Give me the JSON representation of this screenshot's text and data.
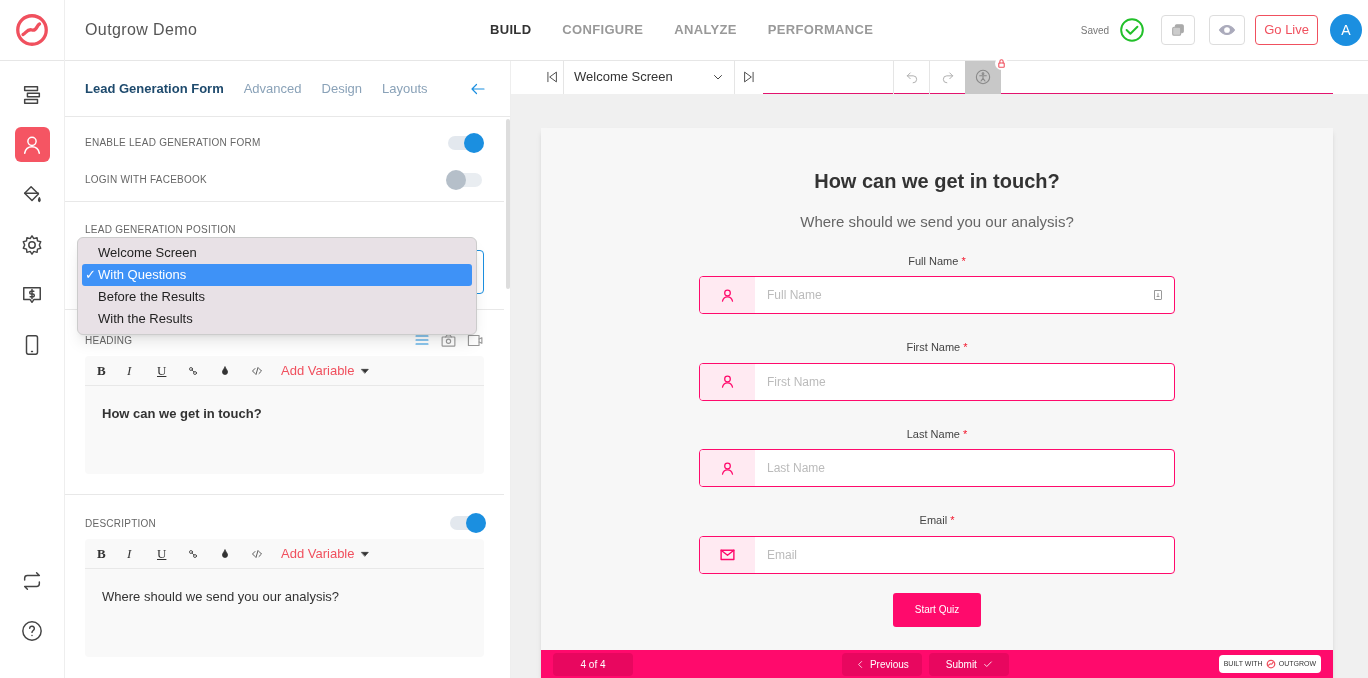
{
  "app": {
    "title": "Outgrow Demo"
  },
  "nav": [
    {
      "label": "BUILD",
      "selected": true
    },
    {
      "label": "CONFIGURE",
      "selected": false
    },
    {
      "label": "ANALYZE",
      "selected": false
    },
    {
      "label": "PERFORMANCE",
      "selected": false
    }
  ],
  "header": {
    "saved": "Saved",
    "go_live": "Go Live",
    "avatar": "A"
  },
  "rail": {
    "items": [
      {
        "kind": "layout",
        "selected": false
      },
      {
        "kind": "user",
        "selected": true
      },
      {
        "kind": "paint",
        "selected": false
      },
      {
        "kind": "gear",
        "selected": false
      },
      {
        "kind": "money",
        "selected": false
      },
      {
        "kind": "mobile",
        "selected": false
      }
    ],
    "bottom": [
      {
        "kind": "sync"
      },
      {
        "kind": "help"
      }
    ]
  },
  "panel": {
    "tabs": [
      {
        "label": "Lead Generation Form",
        "selected": true
      },
      {
        "label": "Advanced",
        "selected": false
      },
      {
        "label": "Design",
        "selected": false
      },
      {
        "label": "Layouts",
        "selected": false
      }
    ],
    "toggles": [
      {
        "label": "ENABLE LEAD GENERATION FORM",
        "on": true
      },
      {
        "label": "LOGIN WITH FACEBOOK",
        "on": false
      }
    ],
    "position": {
      "label": "LEAD GENERATION POSITION",
      "options": [
        {
          "label": "Welcome Screen",
          "selected": false
        },
        {
          "label": "With Questions",
          "selected": true
        },
        {
          "label": "Before the Results",
          "selected": false
        },
        {
          "label": "With the Results",
          "selected": false
        }
      ],
      "check": "✓"
    },
    "editors": [
      {
        "label": "HEADING",
        "kind": "heading",
        "format": [
          "B",
          "I",
          "U"
        ],
        "add_variable": "Add Variable",
        "content": "How can we get in touch?"
      },
      {
        "label": "DESCRIPTION",
        "kind": "description",
        "on": true,
        "format": [
          "B",
          "I",
          "U"
        ],
        "add_variable": "Add Variable",
        "content": "Where should we send you our analysis?"
      }
    ]
  },
  "toolbar": {
    "screen": "Welcome Screen"
  },
  "preview": {
    "title": "How can we get in touch?",
    "subtitle": "Where should we send you our analysis?",
    "fields": [
      {
        "label": "Full Name",
        "mark": "*",
        "placeholder": "Full Name",
        "kind": "person",
        "autofill": true
      },
      {
        "label": "First Name",
        "mark": "*",
        "placeholder": "First Name",
        "kind": "person",
        "autofill": false
      },
      {
        "label": "Last Name",
        "mark": "*",
        "placeholder": "Last Name",
        "kind": "person",
        "autofill": false
      },
      {
        "label": "Email",
        "mark": "*",
        "placeholder": "Email",
        "kind": "mail",
        "autofill": false
      }
    ],
    "button": "Start Quiz",
    "footer": {
      "progress": "4 of 4",
      "previous": "Previous",
      "submit": "Submit",
      "badge_left": "BUILT WITH",
      "badge_right": "OUTGROW"
    }
  }
}
